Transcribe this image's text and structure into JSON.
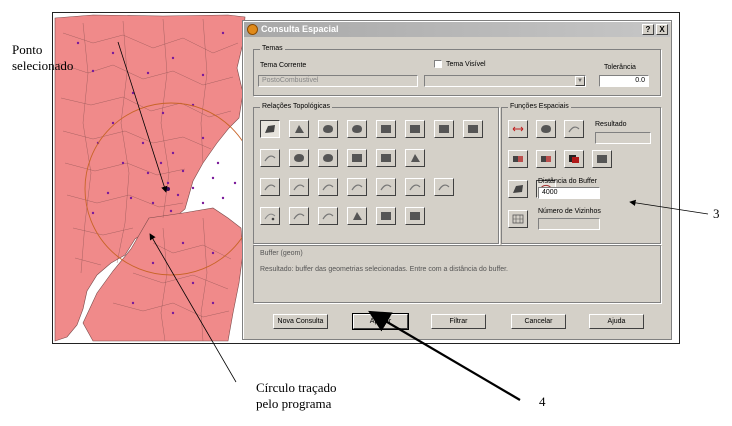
{
  "dialog": {
    "title": "Consulta Espacial",
    "help_button": "?",
    "close_button": "X",
    "temas": {
      "group_label": "Temas",
      "tema_corrente_label": "Tema Corrente",
      "tema_corrente_value": "PostoCombustivel",
      "tema_visivel_label": "Tema Visível",
      "tema_visivel_value": "",
      "tolerancia_label": "Tolerância",
      "tolerancia_value": "0.0"
    },
    "relacoes": {
      "group_label": "Relações Topológicas"
    },
    "funcoes": {
      "group_label": "Funções Espaciais",
      "resultado_label": "Resultado",
      "resultado_value": "",
      "distancia_label": "Distância do Buffer",
      "distancia_value": "4000",
      "vizinhos_label": "Número de Vizinhos",
      "vizinhos_value": ""
    },
    "info_title": "Buffer (geom)",
    "info_text": "Resultado: buffer das geometrias selecionadas. Entre com a distância do buffer.",
    "buttons": {
      "nova_consulta": "Nova Consulta",
      "aplicar": "Aplicar",
      "filtrar": "Filtrar",
      "cancelar": "Cancelar",
      "ajuda": "Ajuda"
    }
  },
  "annotations": {
    "ponto_line1": "Ponto",
    "ponto_line2": "selecionado",
    "circulo_line1": "Círculo traçado",
    "circulo_line2": "pelo programa",
    "label_3": "3",
    "label_4": "4"
  },
  "colors": {
    "map_fill": "#f08a8a",
    "map_points": "#7a1a9a",
    "buffer_circle": "#c86428",
    "dialog_bg": "#d4d0c8"
  }
}
